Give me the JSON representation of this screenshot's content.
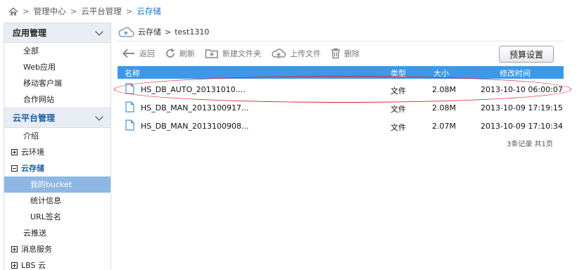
{
  "breadcrumb": {
    "items": [
      "管理中心",
      "云平台管理"
    ],
    "current": "云存储"
  },
  "sidebar": {
    "app_group": {
      "title": "应用管理",
      "items": [
        "全部",
        "Web应用",
        "移动客户端",
        "合作网站"
      ]
    },
    "cloud_group": {
      "title": "云平台管理",
      "intro": "介绍",
      "cloud_env": "云环境",
      "cloud_storage": "云存储",
      "storage_sub": [
        "我的bucket",
        "统计信息",
        "URL签名"
      ],
      "push": "云推送",
      "message": "消息服务",
      "lbs": "LBS 云"
    }
  },
  "path": {
    "root": "云存储",
    "separator": ">",
    "bucket": "test1310"
  },
  "toolbar": {
    "back": "返回",
    "refresh": "刷新",
    "new_folder": "新建文件夹",
    "upload": "上传文件",
    "delete": "删除",
    "budget": "预算设置"
  },
  "table": {
    "headers": {
      "name": "名称",
      "type": "类型",
      "size": "大小",
      "modified": "修改时间"
    },
    "rows": [
      {
        "name": "HS_DB_AUTO_20131010....",
        "type": "文件",
        "size": "2.08M",
        "modified": "2013-10-10 06:00:07"
      },
      {
        "name": "HS_DB_MAN_2013100917...",
        "type": "文件",
        "size": "2.08M",
        "modified": "2013-10-09 17:19:15"
      },
      {
        "name": "HS_DB_MAN_2013100908...",
        "type": "文件",
        "size": "2.07M",
        "modified": "2013-10-09 17:10:34"
      }
    ],
    "summary": "3条记录   共1页"
  },
  "colors": {
    "accent": "#3d98e8",
    "active_nav": "#8fb7e3",
    "highlight": "#e0232a"
  }
}
